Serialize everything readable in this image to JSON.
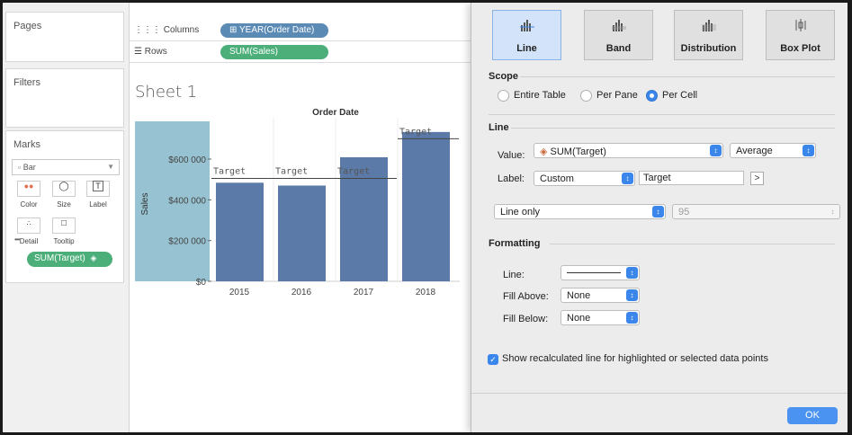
{
  "left": {
    "pages": "Pages",
    "filters": "Filters",
    "marks": {
      "title": "Marks",
      "mark_type": "Bar",
      "buttons": [
        "Color",
        "Size",
        "Label",
        "Detail",
        "Tooltip"
      ],
      "field_pill": "SUM(Target)"
    }
  },
  "shelves": {
    "columns_label": "Columns",
    "columns_pill": "YEAR(Order Date)",
    "rows_label": "Rows",
    "rows_pill": "SUM(Sales)"
  },
  "sheet": {
    "title": "Sheet 1",
    "column_header": "Order Date",
    "colors": {
      "bar": "#5b7aa8",
      "highlight": "#97c2d1"
    }
  },
  "chart_data": {
    "type": "bar",
    "categories": [
      "2015",
      "2016",
      "2017",
      "2018"
    ],
    "values": [
      484000,
      470000,
      609000,
      733000
    ],
    "ylabel": "Sales",
    "ylim": [
      0,
      750000
    ],
    "yticks": [
      0,
      200000,
      400000,
      600000
    ],
    "ytick_labels": [
      "$0",
      "$200 000",
      "$400 000",
      "$600 000"
    ],
    "reference_lines": [
      {
        "label": "Target",
        "value": 505000,
        "categories": [
          "2015",
          "2016",
          "2017"
        ]
      },
      {
        "label": "Target",
        "value": 700000,
        "categories": [
          "2018"
        ]
      }
    ]
  },
  "dialog": {
    "types": [
      "Line",
      "Band",
      "Distribution",
      "Box Plot"
    ],
    "selected_type": "Line",
    "scope_title": "Scope",
    "scope_options": [
      "Entire Table",
      "Per Pane",
      "Per Cell"
    ],
    "scope_selected": "Per Cell",
    "line_title": "Line",
    "value_label": "Value:",
    "value_field": "SUM(Target)",
    "value_agg": "Average",
    "label_label": "Label:",
    "label_mode": "Custom",
    "label_text": "Target",
    "insert_button": ">",
    "line_mode": "Line only",
    "percent": "95",
    "formatting_title": "Formatting",
    "line_fmt_label": "Line:",
    "fill_above_label": "Fill Above:",
    "fill_above": "None",
    "fill_below_label": "Fill Below:",
    "fill_below": "None",
    "recalc_label": "Show recalculated line for highlighted or selected data points",
    "ok": "OK"
  }
}
